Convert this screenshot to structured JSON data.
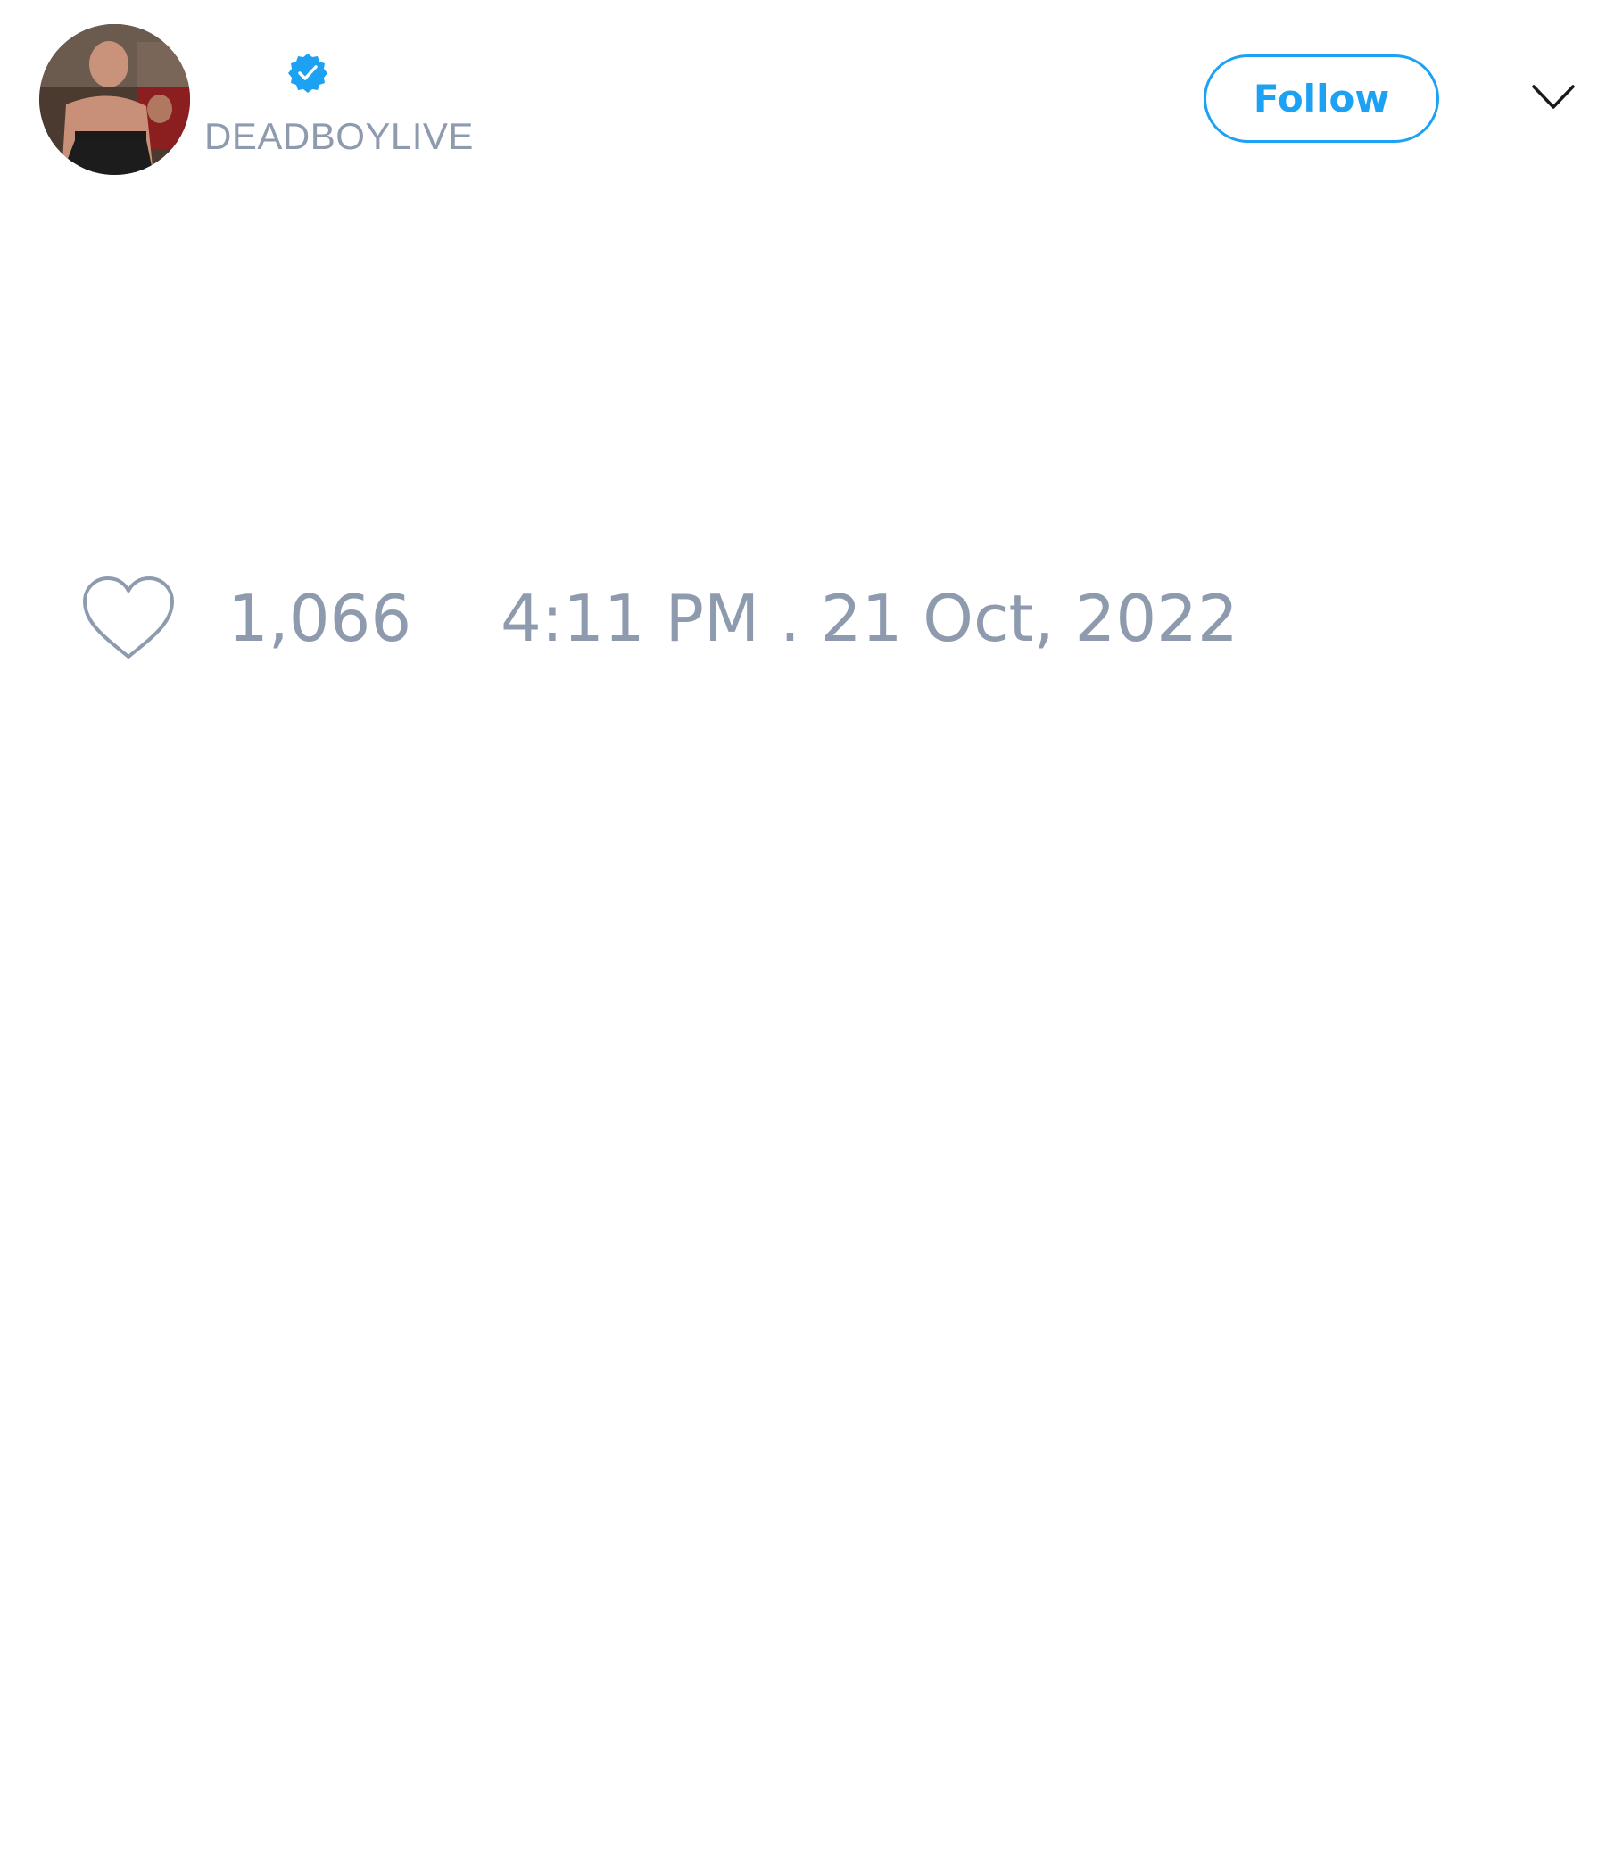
{
  "author": {
    "display_name": "",
    "handle": "DEADBOYLIVE",
    "verified": true,
    "avatar_icon": "profile-photo"
  },
  "header": {
    "follow_label": "Follow",
    "menu_icon": "chevron-down-icon"
  },
  "stats": {
    "like_icon": "heart-icon",
    "like_count": "1,066",
    "timestamp": "4:11 PM . 21 Oct, 2022"
  },
  "colors": {
    "accent": "#1da1f2",
    "muted_text": "#8e9bae",
    "icon_stroke": "#8e9bae",
    "chevron": "#1a1a1a",
    "background": "#ffffff"
  }
}
